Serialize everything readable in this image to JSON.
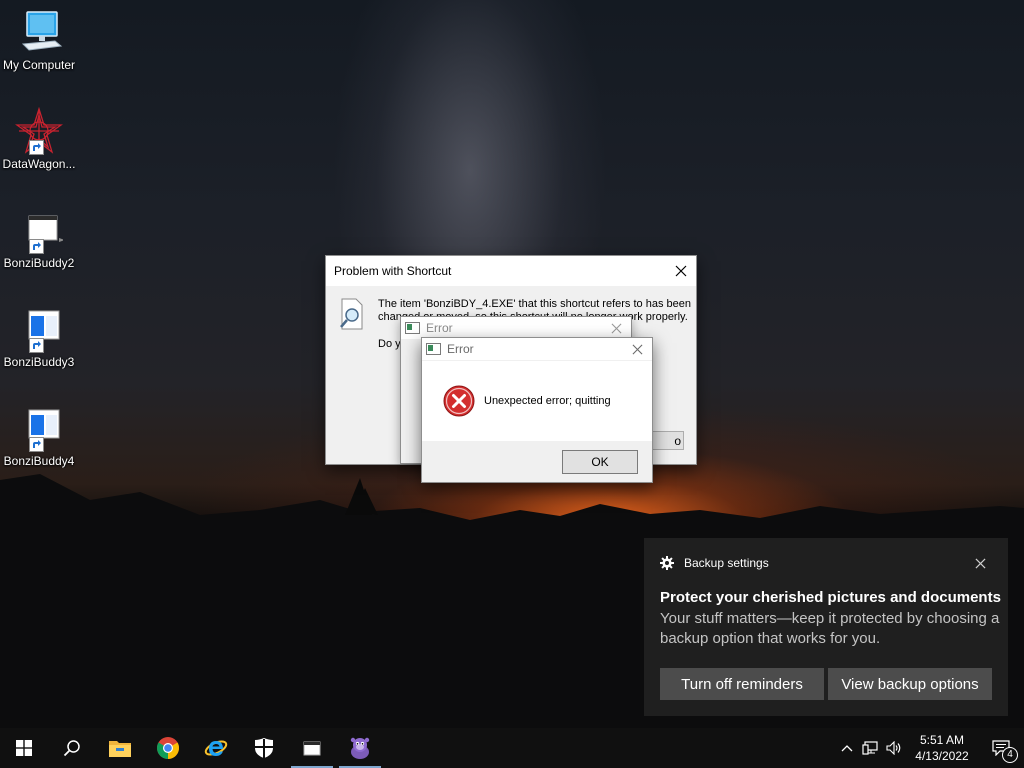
{
  "desktop": {
    "icons": [
      {
        "label": "My Computer"
      },
      {
        "label": "DataWagon..."
      },
      {
        "label": "BonziBuddy2"
      },
      {
        "label": "BonziBuddy3"
      },
      {
        "label": "BonziBuddy4"
      }
    ]
  },
  "shortcut_dialog": {
    "title": "Problem with Shortcut",
    "message_line1": "The item 'BonziBDY_4.EXE' that this shortcut refers to has been",
    "message_line2": "changed or moved, so this shortcut will no longer work properly.",
    "question_fragment": "Do y",
    "button_fragment": "o"
  },
  "error_dialog_back": {
    "title": "Error"
  },
  "error_dialog_front": {
    "title": "Error",
    "message": "Unexpected error; quitting",
    "ok_label": "OK"
  },
  "toast": {
    "app_name": "Backup settings",
    "title": "Protect your cherished pictures and documents",
    "body": "Your stuff matters—keep it protected by choosing a backup option that works for you.",
    "button_left": "Turn off reminders",
    "button_right": "View backup options"
  },
  "taskbar": {
    "pinned": [
      "start-icon",
      "search-icon",
      "file-explorer-icon",
      "chrome-icon",
      "internet-explorer-icon",
      "security-shield-icon",
      "application-window-icon",
      "bonzibuddy-icon"
    ],
    "clock_time": "5:51 AM",
    "clock_date": "4/13/2022",
    "notification_count": "4"
  },
  "colors": {
    "taskbar_bg": "#101010",
    "toast_bg": "#1f1f1f",
    "toast_button_bg": "#4c4c4c",
    "error_red": "#d32f2f",
    "dialog_bg": "#f0f0f0"
  }
}
